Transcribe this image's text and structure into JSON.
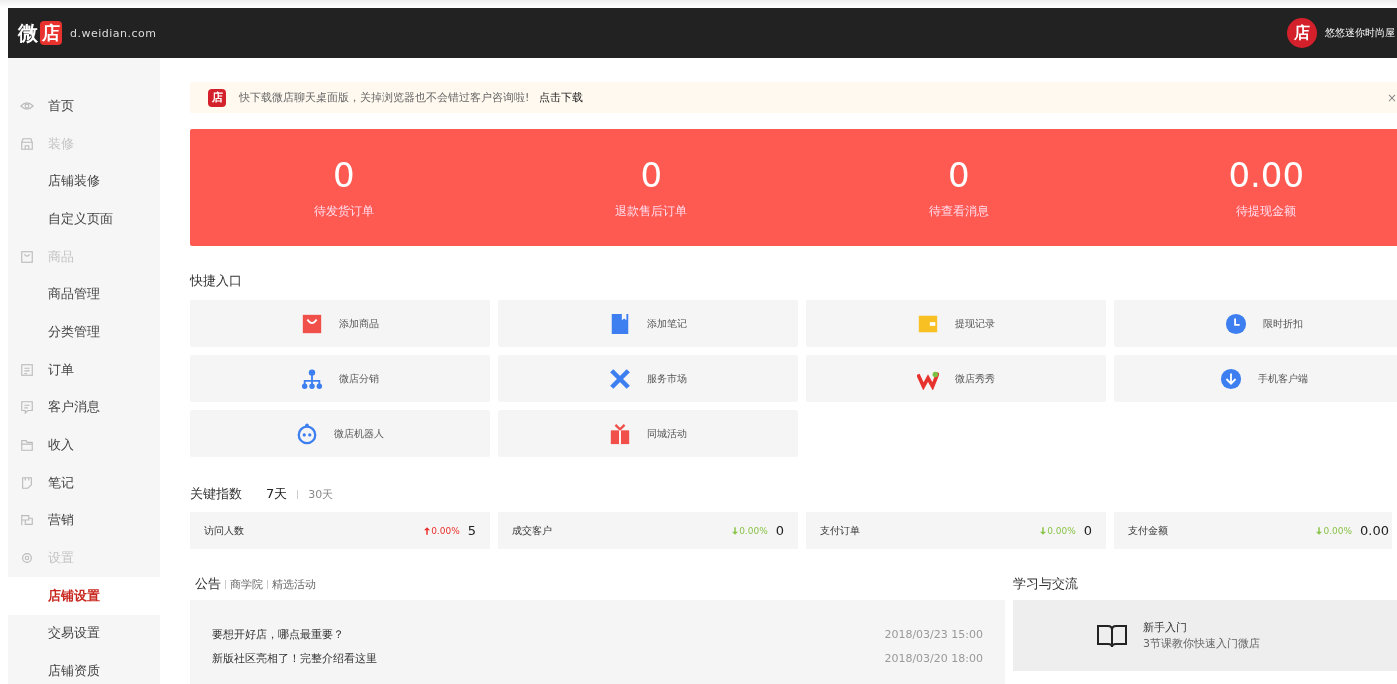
{
  "header": {
    "logo": "微",
    "logo_badge": "店",
    "domain": "d.weidian.com",
    "avatar": "店",
    "shop_name": "悠悠迷你时尚屋"
  },
  "sidebar": {
    "items": [
      {
        "kind": "section",
        "label": "首页",
        "disabled": false,
        "selected": false
      },
      {
        "kind": "section",
        "label": "装修",
        "disabled": true,
        "selected": false
      },
      {
        "kind": "item",
        "label": "店铺装修",
        "selected": false
      },
      {
        "kind": "item",
        "label": "自定义页面",
        "selected": false
      },
      {
        "kind": "section",
        "label": "商品",
        "disabled": true,
        "selected": false
      },
      {
        "kind": "item",
        "label": "商品管理",
        "selected": false
      },
      {
        "kind": "item",
        "label": "分类管理",
        "selected": false
      },
      {
        "kind": "section",
        "label": "订单",
        "disabled": false,
        "selected": false
      },
      {
        "kind": "section",
        "label": "客户消息",
        "disabled": false,
        "selected": false
      },
      {
        "kind": "section",
        "label": "收入",
        "disabled": false,
        "selected": false
      },
      {
        "kind": "section",
        "label": "笔记",
        "disabled": false,
        "selected": false
      },
      {
        "kind": "section",
        "label": "营销",
        "disabled": false,
        "selected": false
      },
      {
        "kind": "section",
        "label": "设置",
        "disabled": true,
        "selected": false
      },
      {
        "kind": "item",
        "label": "店铺设置",
        "selected": true
      },
      {
        "kind": "item",
        "label": "交易设置",
        "selected": false
      },
      {
        "kind": "item",
        "label": "店铺资质",
        "selected": false
      }
    ]
  },
  "notice": {
    "icon_text": "店",
    "text": "快下载微店聊天桌面版，关掉浏览器也不会错过客户咨询啦!",
    "link": "点击下载",
    "close": "×"
  },
  "stats": [
    {
      "value": "0",
      "label": "待发货订单"
    },
    {
      "value": "0",
      "label": "退款售后订单"
    },
    {
      "value": "0",
      "label": "待查看消息"
    },
    {
      "value": "0.00",
      "label": "待提现金额"
    }
  ],
  "shortcuts": {
    "title": "快捷入口",
    "items": [
      {
        "label": "添加商品"
      },
      {
        "label": "添加笔记"
      },
      {
        "label": "提现记录"
      },
      {
        "label": "限时折扣"
      },
      {
        "label": "微店分销"
      },
      {
        "label": "服务市场"
      },
      {
        "label": "微店秀秀"
      },
      {
        "label": "手机客户端"
      },
      {
        "label": "微店机器人"
      },
      {
        "label": "同城活动"
      }
    ]
  },
  "metrics": {
    "title": "关键指数",
    "ranges": [
      {
        "label": "7天",
        "selected": true
      },
      {
        "label": "30天",
        "selected": false
      }
    ],
    "items": [
      {
        "label": "访问人数",
        "kind": "up",
        "change": "0.00%",
        "value": "5"
      },
      {
        "label": "成交客户",
        "kind": "down",
        "change": "0.00%",
        "value": "0"
      },
      {
        "label": "支付订单",
        "kind": "down",
        "change": "0.00%",
        "value": "0"
      },
      {
        "label": "支付金额",
        "kind": "down",
        "change": "0.00%",
        "value": "0.00"
      }
    ]
  },
  "news": {
    "tabs": [
      {
        "label": "公告",
        "selected": true
      },
      {
        "label": "商学院",
        "selected": false
      },
      {
        "label": "精选活动",
        "selected": false
      }
    ],
    "items": [
      {
        "title": "要想开好店，哪点最重要？",
        "date": "2018/03/23 15:00"
      },
      {
        "title": "新版社区亮相了！完整介绍看这里",
        "date": "2018/03/20 18:00"
      }
    ]
  },
  "learning": {
    "title": "学习与交流",
    "card": {
      "title": "新手入门",
      "subtitle": "3节课教你快速入门微店"
    }
  }
}
